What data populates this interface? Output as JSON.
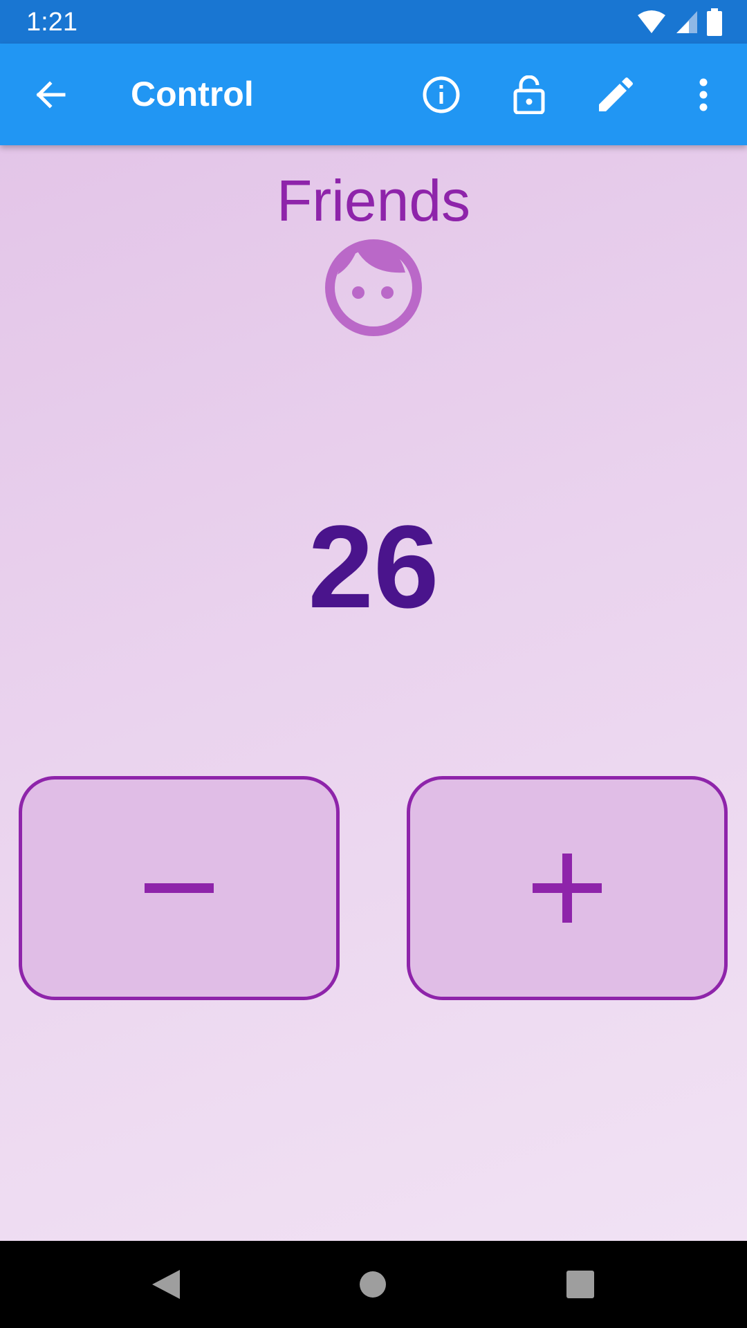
{
  "status_bar": {
    "time": "1:21",
    "icons": [
      "wifi-icon",
      "cell-signal-icon",
      "battery-icon"
    ]
  },
  "app_bar": {
    "title": "Control",
    "actions": [
      "back-arrow-icon",
      "info-icon",
      "lock-open-icon",
      "edit-pencil-icon",
      "more-vert-icon"
    ]
  },
  "counter": {
    "name": "Friends",
    "icon": "face-icon",
    "value": "26"
  },
  "buttons": {
    "decrement_icon": "minus-icon",
    "increment_icon": "plus-icon"
  },
  "nav_bar": {
    "icons": [
      "nav-back-icon",
      "nav-home-icon",
      "nav-recents-icon"
    ]
  },
  "colors": {
    "status_bar": "#1976d2",
    "app_bar": "#2196f3",
    "accent": "#8e24aa",
    "value_text": "#4a148c",
    "button_fill": "#e0bde6"
  }
}
